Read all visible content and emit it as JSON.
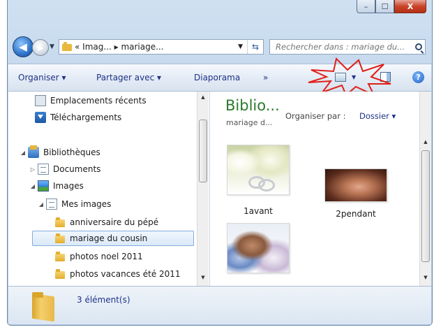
{
  "window": {
    "controls": {
      "minimize": "–",
      "maximize": "☐",
      "close": "X"
    }
  },
  "address": {
    "path_text": "« Imag... ▸ mariage...",
    "search_placeholder": "Rechercher dans : mariage du..."
  },
  "toolbar": {
    "organize": "Organiser ▾",
    "share": "Partager avec ▾",
    "slideshow": "Diaporama",
    "more": "»",
    "help": "?"
  },
  "nav": {
    "items": [
      {
        "label": "Emplacements récents",
        "icon": "recent-places-icon"
      },
      {
        "label": "Téléchargements",
        "icon": "downloads-icon"
      },
      {
        "label": "Bibliothèques",
        "icon": "libraries-icon"
      },
      {
        "label": "Documents",
        "icon": "documents-icon"
      },
      {
        "label": "Images",
        "icon": "images-icon"
      },
      {
        "label": "Mes images",
        "icon": "my-pictures-icon"
      },
      {
        "label": "anniversaire du pépé",
        "icon": "folder-icon"
      },
      {
        "label": "mariage du cousin",
        "icon": "folder-icon",
        "selected": true
      },
      {
        "label": "photos noel 2011",
        "icon": "folder-icon"
      },
      {
        "label": "photos vacances été 2011",
        "icon": "folder-icon"
      }
    ]
  },
  "content": {
    "library_title": "Biblio...",
    "library_subtitle": "mariage d...",
    "arrange_label": "Organiser par :",
    "arrange_value": "Dossier ▾",
    "files": [
      {
        "name": "1avant"
      },
      {
        "name": "2pendant"
      },
      {
        "name": ""
      }
    ]
  },
  "status": {
    "count": "3 élément(s)"
  },
  "colors": {
    "accent_link": "#1e3287",
    "library_title": "#2b7a2b",
    "highlight_burst": "#e0201a"
  }
}
